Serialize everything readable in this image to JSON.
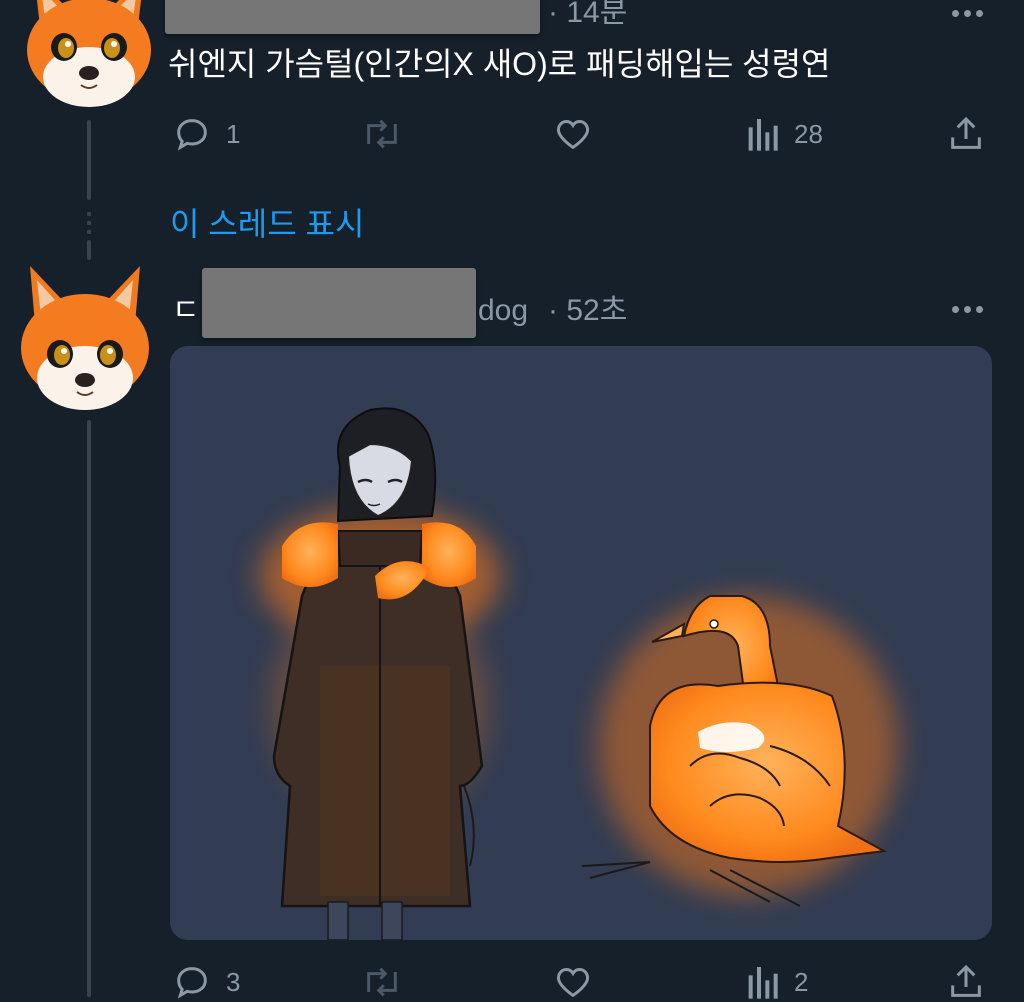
{
  "tweet1": {
    "time": "· 14분",
    "text": "쉬엔지 가슴털(인간의X 새O)로 패딩해입는 성령연",
    "actions": {
      "replies": "1",
      "retweets": "",
      "likes": "",
      "views": "28"
    }
  },
  "thread": {
    "show_thread_label": "이 스레드 표시"
  },
  "tweet2": {
    "name_prefix": "ㄷ",
    "handle_suffix": "dog",
    "time": "· 52초",
    "actions": {
      "replies": "3",
      "retweets": "",
      "likes": "",
      "views": "2"
    }
  },
  "icons": {
    "reply": "reply-icon",
    "retweet": "retweet-icon",
    "like": "heart-icon",
    "views": "views-icon",
    "share": "share-icon",
    "more": "more-icon"
  },
  "colors": {
    "background": "#15202b",
    "accent": "#1d9bf0",
    "muted": "#8b98a5",
    "glow": "#ff8a1e"
  }
}
